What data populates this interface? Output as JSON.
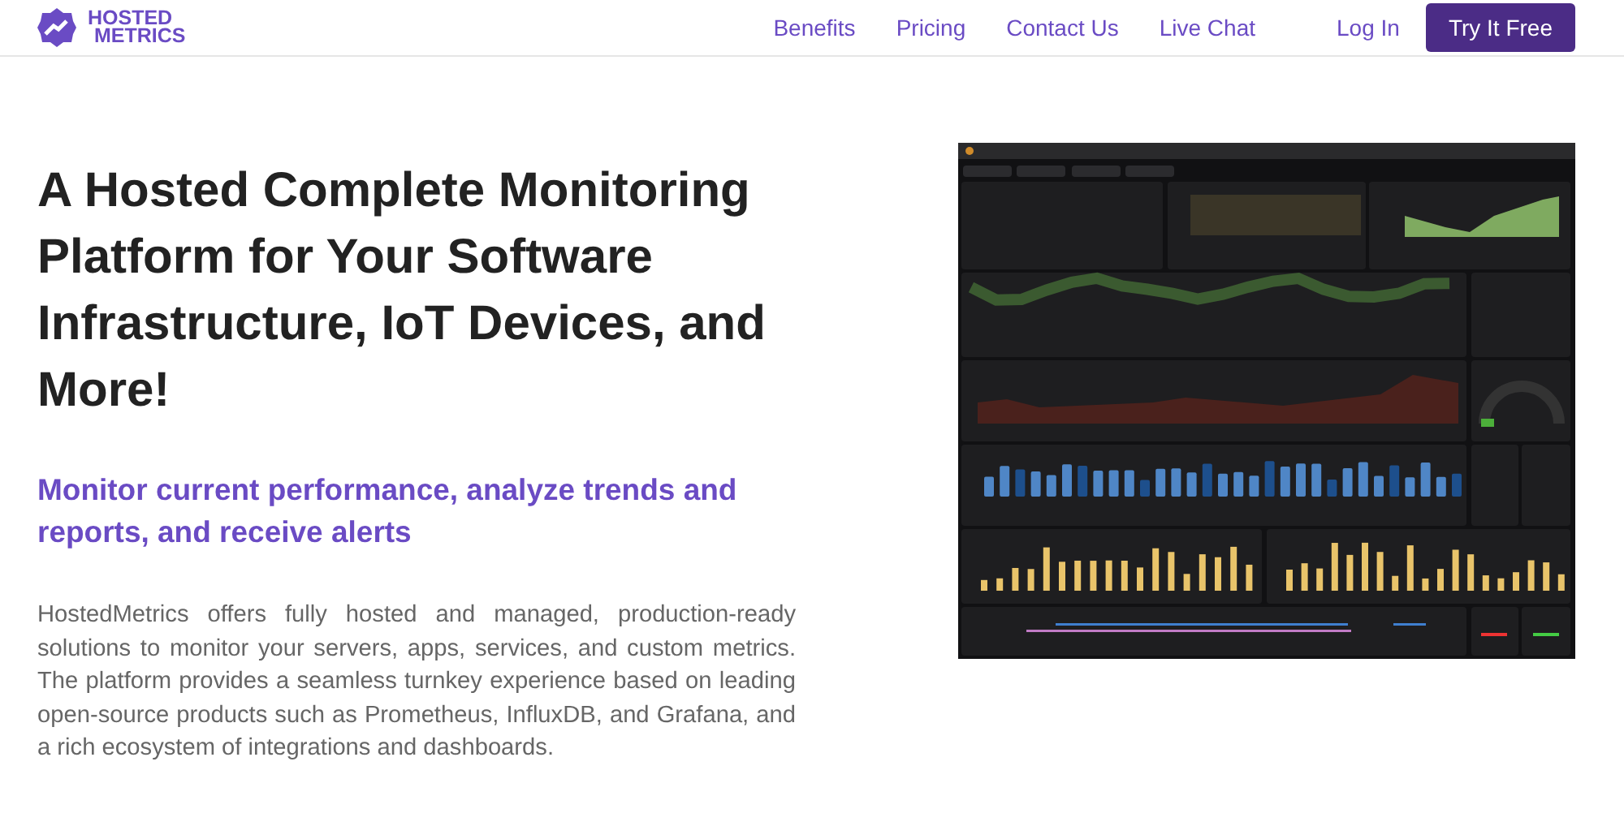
{
  "logo": {
    "line_1": "HOSTED",
    "line_2": "METRICS"
  },
  "nav": {
    "links": [
      "Benefits",
      "Pricing",
      "Contact Us",
      "Live Chat"
    ],
    "login": "Log In",
    "cta": "Try It Free"
  },
  "hero": {
    "title": "A Hosted Complete Monitoring Platform for Your Software Infrastructure, IoT Devices, and More!",
    "subtitle": "Monitor current performance, analyze trends and reports, and receive alerts",
    "body": "HostedMetrics offers fully hosted and managed, production-ready solutions to monitor your servers, apps, services, and custom metrics. The platform provides a seamless turnkey experience based on leading open-source products such as Prometheus, InfluxDB, and Grafana, and a rich ecosystem of integrations and dashboards."
  }
}
